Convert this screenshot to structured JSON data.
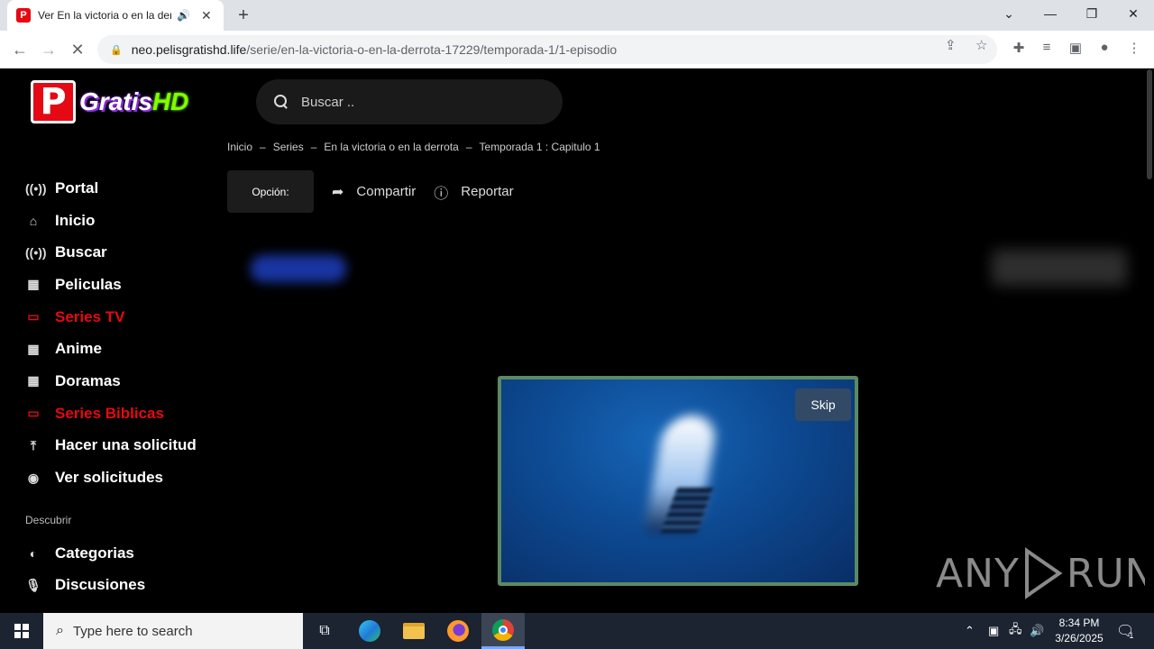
{
  "browser": {
    "tab_title": "Ver En la victoria o en la derrota",
    "url_host": "neo.pelisgratishd.life",
    "url_path": "/serie/en-la-victoria-o-en-la-derrota-17229/temporada-1/1-episodio"
  },
  "site": {
    "logo_letter": "P",
    "logo_text": "Gratis",
    "logo_hd": "HD",
    "search_placeholder": "Buscar .."
  },
  "breadcrumb": [
    "Inicio",
    "Series",
    "En la victoria o en la derrota",
    "Temporada 1 : Capitulo 1"
  ],
  "breadcrumb_sep": "–",
  "actions": {
    "option_label": "Opción:",
    "share_label": "Compartir",
    "report_label": "Reportar"
  },
  "sidebar": {
    "items": [
      {
        "label": "Portal",
        "icon": "broadcast-icon"
      },
      {
        "label": "Inicio",
        "icon": "home-icon"
      },
      {
        "label": "Buscar",
        "icon": "broadcast-icon"
      },
      {
        "label": "Peliculas",
        "icon": "film-icon"
      },
      {
        "label": "Series TV",
        "icon": "tv-icon",
        "active": true
      },
      {
        "label": "Anime",
        "icon": "film-icon"
      },
      {
        "label": "Doramas",
        "icon": "film-icon"
      },
      {
        "label": "Series Biblicas",
        "icon": "tv-icon",
        "active": true
      },
      {
        "label": "Hacer una solicitud",
        "icon": "upload-icon"
      },
      {
        "label": "Ver solicitudes",
        "icon": "eye-icon"
      }
    ],
    "discover_label": "Descubrir",
    "discover_items": [
      {
        "label": "Categorias",
        "icon": "half-circle-icon"
      },
      {
        "label": "Discusiones",
        "icon": "mic-icon"
      }
    ]
  },
  "ad": {
    "skip_label": "Skip"
  },
  "watermark": {
    "left": "ANY",
    "right": "RUN"
  },
  "taskbar": {
    "search_placeholder": "Type here to search",
    "time": "8:34 PM",
    "date": "3/26/2025",
    "notification_count": "1"
  },
  "colors": {
    "accent": "#e50914",
    "page_bg": "#000000",
    "ad_border": "#5a8a63"
  }
}
